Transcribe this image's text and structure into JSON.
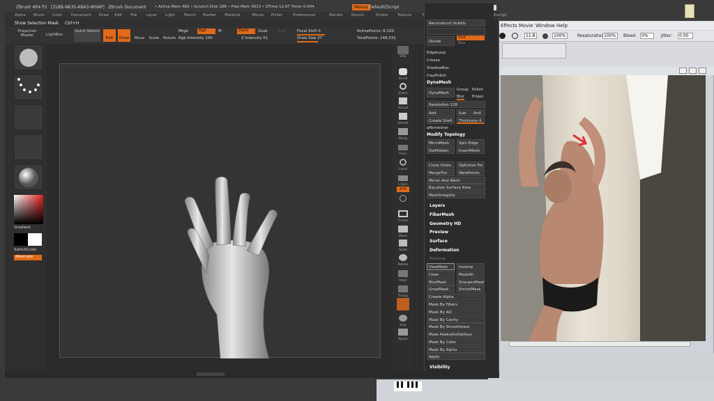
{
  "zbrush": {
    "title_items": [
      "ZBrush 4R4 P2",
      "[ZLBB-NK3S-ABA3-WHAP]",
      "ZBrush Document",
      "• Active Mem 482 • Scratch Disk 188 • Free Mem 3013 • ZTime 12.67 Timer 0.004"
    ],
    "menu_button": "Menus",
    "default_script": "DefaultZScript",
    "menu": [
      "Alpha",
      "Brush",
      "Color",
      "Document",
      "Draw",
      "Edit",
      "File",
      "Layer",
      "Light",
      "Macro",
      "Marker",
      "Material",
      "Movie",
      "Picker",
      "Preferences",
      "Render",
      "Stencil",
      "Stroke",
      "Texture",
      "Tool",
      "Transform",
      "Zplugin",
      "Zscript"
    ],
    "info": {
      "show_selection_mask": "Show Selection Mask",
      "shortcut": "Ctrl+H"
    },
    "shelf": {
      "projection_master": "Projection Master",
      "lightbox": "LightBox",
      "quick_sketch": "Quick Sketch",
      "edit": "Edit",
      "draw": "Draw",
      "move": "Move",
      "scale": "Scale",
      "rotate": "Rotate",
      "mrgb": "Mrgb",
      "rgb": "Rgb",
      "m": "M",
      "zadd": "Zadd",
      "zsub": "Zsub",
      "zcut": "Zcut",
      "rgb_intensity": "Rgb Intensity 100",
      "z_intensity": "Z Intensity 51",
      "focal_shift": "Focal Shift 0",
      "draw_size": "Draw Size 37",
      "active_points": "ActivePoints: 8,320",
      "total_points": "TotalPoints: 148,531"
    },
    "left": {
      "gradient": "Gradient",
      "switch_color": "SwitchColor",
      "alternate": "Alternate"
    },
    "right_icons": [
      "SPix",
      "Scroll",
      "Zoom",
      "Actual",
      "AAHalf",
      "Persp",
      "Floor",
      "Local",
      "L.Sym",
      "XYZ",
      "",
      "Frame",
      "Move",
      "Scale",
      "Rotate",
      "PolyF",
      "Transp",
      "Ghost",
      "Solo",
      "Xpose"
    ],
    "tray": {
      "reconstruct_subdiv": "Reconstruct Subdiv",
      "divide": "Divide",
      "smt": "Smt",
      "suv": "Suv",
      "edgeloop": "EdgeLoop",
      "crease": "Crease",
      "shadowbox": "ShadowBox",
      "claypolish": "ClayPolish",
      "dynamesh_hdr": "DynaMesh",
      "dynamesh": "DynaMesh",
      "group": "Group",
      "polish": "Polish",
      "blur": "Blur",
      "project": "Projec",
      "resolution": "Resolution 128",
      "add": "Add",
      "sub": "Sub",
      "and": "And",
      "create_shell": "Create Shell",
      "thickness": "Thickness 4",
      "qremesher": "qRemesher",
      "modify_topology": "Modify Topology",
      "micromesh": "MicroMesh",
      "spin_edge": "Spin Edge",
      "delhidden": "DelHidden",
      "insert_mesh": "InsertMesh",
      "close_holes": "Close Holes",
      "optimize_points": "Optimize Poi",
      "merge_tris": "MergeTris",
      "weld_points": "WeldPoints",
      "mirror_and_weld": "Mirror And Weld",
      "equalize_surface_area": "Equalize Surface Area",
      "mesh_integrity": "MeshIntegrity",
      "layers": "Layers",
      "fibermesh": "FiberMesh",
      "geometry_hd": "Geometry HD",
      "preview": "Preview",
      "surface": "Surface",
      "deformation": "Deformation",
      "masking": "Masking",
      "viewmask": "ViewMask",
      "inverse": "Inverse",
      "clear": "Clear",
      "mask_all": "MaskAll",
      "blurmask": "BlurMask",
      "sharpen_mask": "SharpenMask",
      "grow_mask": "GrowMask",
      "shrink_mask": "ShrinkMask",
      "create_alpha": "Create Alpha",
      "mask_by_fibers": "Mask By Fibers",
      "mask_by_ao": "Mask By AO",
      "mask_by_cavity": "Mask By Cavity",
      "mask_by_smoothness": "Mask By Smoothness",
      "mask_peaks_valleys": "Mask PeaksAndValleys",
      "mask_by_color": "Mask By Color",
      "mask_by_alpha": "Mask By Alpha",
      "apply": "Apply",
      "visibility": "Visibility"
    },
    "colors": {
      "accent": "#e06a1a",
      "panel": "#2c2c2c"
    }
  },
  "photoshop": {
    "menu": [
      "Effects",
      "Movie",
      "Help"
    ],
    "options": {
      "size": "11.8",
      "pct1": "100%",
      "resat_label": "Resaturation:",
      "resat": "100%",
      "bleed_label": "Bleed:",
      "bleed": "0%",
      "jitter_label": "Jitter:",
      "jitter": "0.00"
    }
  }
}
